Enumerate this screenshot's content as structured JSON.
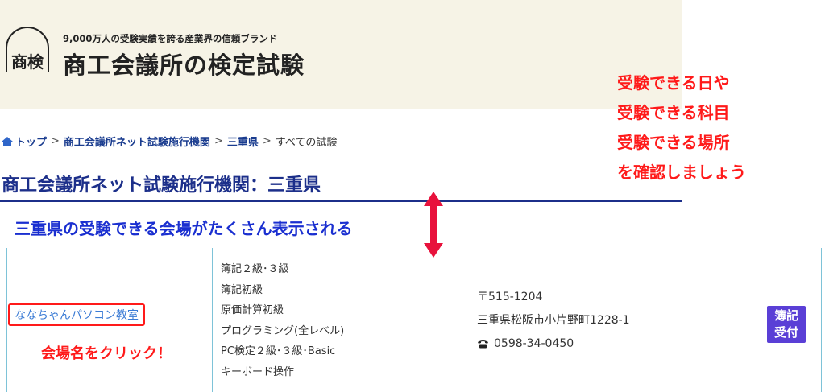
{
  "header": {
    "tagline": "9,000万人の受験実績を誇る産業界の信頼ブランド",
    "site_title": "商工会議所の検定試験",
    "logo_text": "商検"
  },
  "breadcrumb": {
    "home_label": "トップ",
    "items": [
      "商工会議所ネット試験施行機関",
      "三重県"
    ],
    "current": "すべての試験",
    "separator": ">"
  },
  "page_title": "商工会議所ネット試験施行機関：三重県",
  "annotations": {
    "blue": "三重県の受験できる会場がたくさん表示される",
    "red_lines": [
      "受験できる日や",
      "受験できる科目",
      "受験できる場所",
      "を確認しましょう"
    ],
    "click": "会場名をクリック！"
  },
  "venue": {
    "name": "ななちゃんパソコン教室",
    "subjects": [
      "簿記２級･３級",
      "簿記初級",
      "原価計算初級",
      "プログラミング(全レベル)",
      "PC検定２級･３級･Basic",
      "キーボード操作"
    ],
    "postal": "〒515-1204",
    "address": "三重県松阪市小片野町1228-1",
    "phone": "0598-34-0450",
    "badge_lines": [
      "簿記",
      "受付"
    ]
  },
  "colors": {
    "header_bg": "#f6f3e6",
    "title": "#1c2f8a",
    "annotation_red": "#ff1a1a",
    "annotation_blue": "#1a2fd0",
    "link": "#3a7bd5",
    "badge": "#5a3fd6",
    "table_line": "#7ec3d8"
  }
}
